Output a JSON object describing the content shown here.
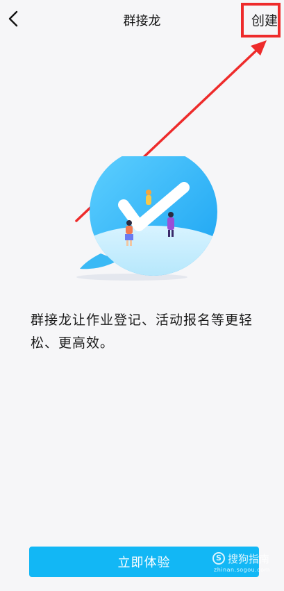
{
  "header": {
    "title": "群接龙",
    "create_label": "创建"
  },
  "description": "群接龙让作业登记、活动报名等更轻松、更高效。",
  "cta_label": "立即体验",
  "watermark": {
    "logo": "S",
    "name": "搜狗指南",
    "url": "zhinan.sogou.com"
  },
  "icons": {
    "back": "back-arrow-icon",
    "illustration": "speech-bubble-checkmark-illustration"
  },
  "colors": {
    "accent": "#12b7f5",
    "annotation_red": "#ee2b2b",
    "background": "#f6f6f8"
  }
}
